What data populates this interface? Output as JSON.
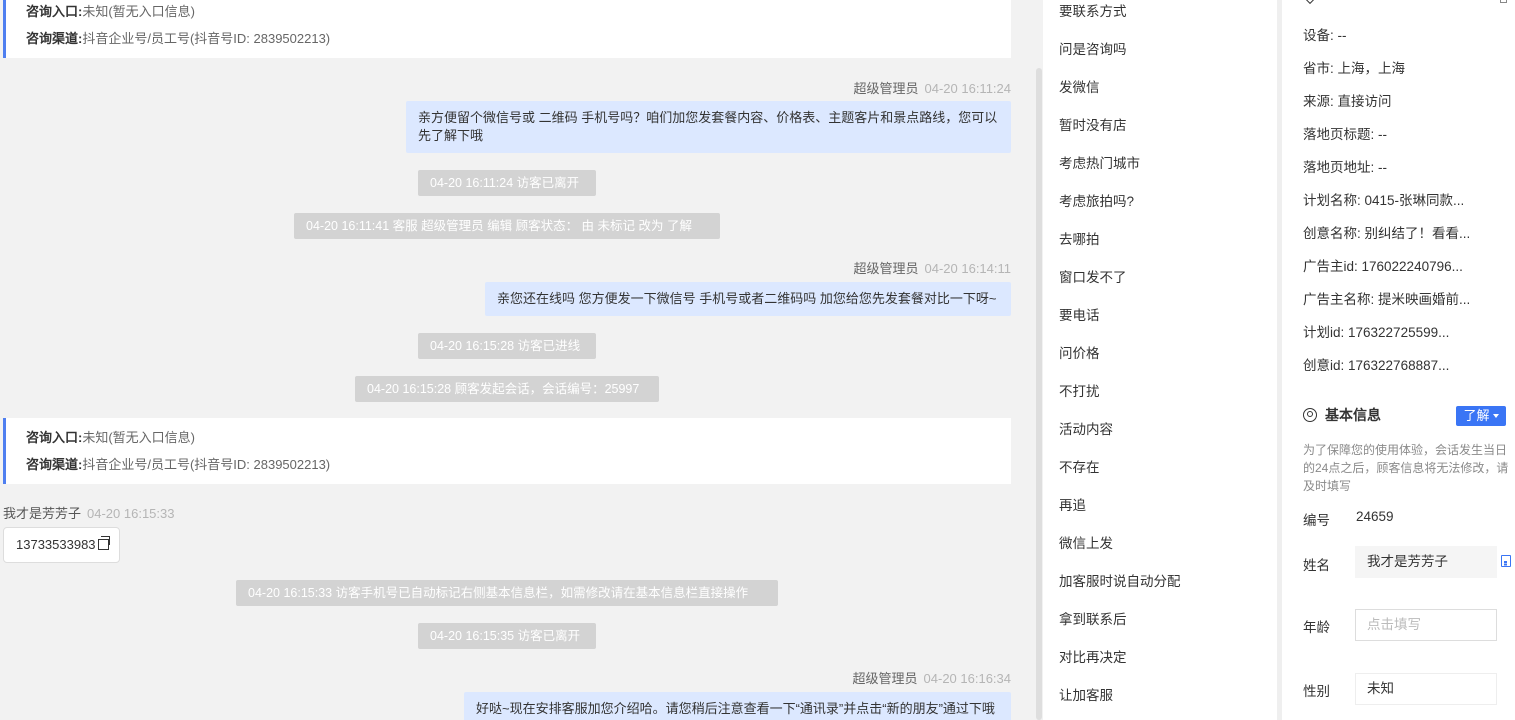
{
  "chat": {
    "cards": [
      {
        "entry_label": "咨询入口:",
        "entry_value": "未知(暂无入口信息)",
        "channel_label": "咨询渠道:",
        "channel_value": "抖音企业号/员工号(抖音号ID: 2839502213)"
      },
      {
        "entry_label": "咨询入口:",
        "entry_value": "未知(暂无入口信息)",
        "channel_label": "咨询渠道:",
        "channel_value": "抖音企业号/员工号(抖音号ID: 2839502213)"
      }
    ],
    "messages": [
      {
        "sender": "超级管理员",
        "time": "04-20 16:11:24",
        "text": "亲方便留个微信号或 二维码 手机号吗？咱们加您发套餐内容、价格表、主题客片和景点路线，您可以先了解下哦"
      },
      {
        "sender": "超级管理员",
        "time": "04-20 16:14:11",
        "text": "亲您还在线吗 您方便发一下微信号 手机号或者二维码吗 加您给您先发套餐对比一下呀~"
      },
      {
        "sender": "我才是芳芳子",
        "time": "04-20 16:15:33",
        "text": "13733533983"
      },
      {
        "sender": "超级管理员",
        "time": "04-20 16:16:34",
        "text": "好哒~现在安排客服加您介绍哈。请您稍后注意查看一下“通讯录”并点击“新的朋友”通过下哦"
      }
    ],
    "system": [
      "04-20 16:11:24 访客已离开",
      "04-20 16:11:41 客服 超级管理员 编辑 顾客状态： 由 未标记 改为 了解",
      "04-20 16:15:28 访客已进线",
      "04-20 16:15:28 顾客发起会话，会话编号：25997",
      "04-20 16:15:33 访客手机号已自动标记右侧基本信息栏，如需修改请在基本信息栏直接操作",
      "04-20 16:15:35 访客已离开"
    ]
  },
  "phrases": [
    "要联系方式",
    "问是咨询吗",
    "发微信",
    "暂时没有店",
    "考虑热门城市",
    "考虑旅拍吗?",
    "去哪拍",
    "窗口发不了",
    "要电话",
    "问价格",
    "不打扰",
    "活动内容",
    "不存在",
    "再追",
    "微信上发",
    "加客服时说自动分配",
    "拿到联系后",
    "对比再决定",
    "让加客服"
  ],
  "panel": {
    "details": [
      "设备: --",
      "省市: 上海，上海",
      "来源: 直接访问",
      "落地页标题: --",
      "落地页地址: --",
      "计划名称: 0415-张琳同款...",
      "创意名称: 别纠结了！看看...",
      "广告主id: 176022240796...",
      "广告主名称: 提米映画婚前...",
      "计划id: 176322725599...",
      "创意id: 176322768887..."
    ],
    "basic_title": "基本信息",
    "status": "了解",
    "note": "为了保障您的使用体验，会话发生当日的24点之后，顾客信息将无法修改，请及时填写",
    "id_label": "编号",
    "id_value": "24659",
    "name_label": "姓名",
    "name_value": "我才是芳芳子",
    "age_label": "年龄",
    "age_placeholder": "点击填写",
    "gender_label": "性别",
    "gender_value": "未知"
  }
}
